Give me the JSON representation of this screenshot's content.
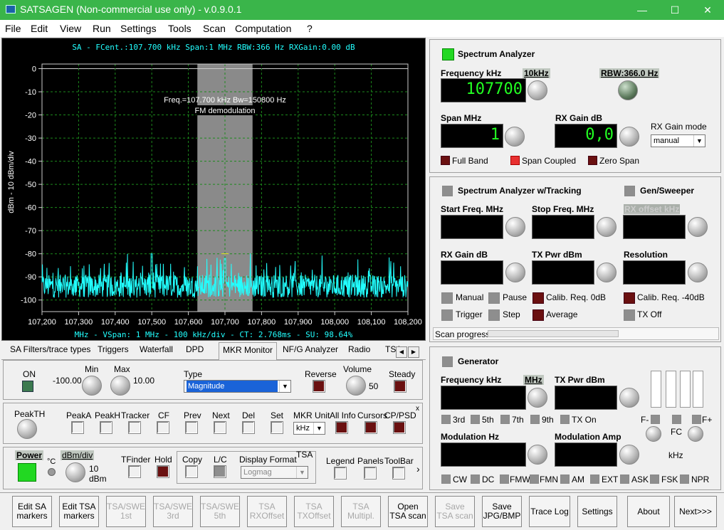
{
  "window": {
    "title": "SATSAGEN (Non-commercial use only) - v.0.9.0.1",
    "minimize": "—",
    "maximize": "☐",
    "close": "✕"
  },
  "menu": [
    "File",
    "Edit",
    "View",
    "Run",
    "Settings",
    "Tools",
    "Scan",
    "Computation",
    "?"
  ],
  "plot": {
    "header": "SA - FCent.:107.700 kHz Span:1 MHz RBW:366 Hz RXGain:0.00 dB",
    "footer": "MHz - VSpan: 1 MHz - 100 kHz/div - CT: 2.768ms - SU: 98.64%",
    "ylabel": "dBm - 10 dBm/div",
    "yticks": [
      "0",
      "-10",
      "-20",
      "-30",
      "-40",
      "-50",
      "-60",
      "-70",
      "-80",
      "-90",
      "-100"
    ],
    "xticks": [
      "107,200",
      "107,300",
      "107,400",
      "107,500",
      "107,600",
      "107,700",
      "107,800",
      "107,900",
      "108,000",
      "108,100",
      "108,200"
    ],
    "band_label1": "Freq.=107.700 kHz Bw=150800 Hz",
    "band_label2": "FM demodulation"
  },
  "chart_data": {
    "type": "line",
    "x_range": [
      107.2,
      108.2
    ],
    "ylim": [
      -105,
      2
    ],
    "xlabel": "MHz",
    "ylabel": "dBm - 10 dBm/div",
    "noise_floor_dbm": -96,
    "peaks": [
      {
        "x": 107.5,
        "y": -80
      },
      {
        "x": 107.7,
        "y": -82
      }
    ],
    "band": {
      "center_khz": 107700,
      "bw_hz": 150800
    },
    "grid": true,
    "color": "#22ffff"
  },
  "tabs": [
    "SA Filters/trace types",
    "Triggers",
    "Waterfall",
    "DPD",
    "MKR Monitor",
    "NF/G Analyzer",
    "Radio",
    "TSA"
  ],
  "mkr_monitor": {
    "on": "ON",
    "min_label": "Min",
    "min_value": "-100.00",
    "max_label": "Max",
    "max_value": "10.00",
    "type_label": "Type",
    "type_value": "Magnitude",
    "reverse": "Reverse",
    "volume_label": "Volume",
    "volume_value": "50",
    "steady": "Steady"
  },
  "markers": {
    "peakth": "PeakTH",
    "peaka": "PeakA",
    "peakh": "PeakH",
    "tracker": "Tracker",
    "cf": "CF",
    "prev": "Prev",
    "next": "Next",
    "del": "Del",
    "set": "Set",
    "unit_label": "MKR Unit",
    "unit_value": "kHz",
    "allinfo": "All Info",
    "cursors": "Cursors",
    "cppsd": "CP/PSD",
    "close": "x"
  },
  "bottom_tool": {
    "power": "Power",
    "degc": "°C",
    "dbm_div": "dBm/div",
    "dbm_div_value": "10",
    "dbm_unit": "dBm",
    "tfinder": "TFinder",
    "hold": "Hold",
    "copy": "Copy",
    "lc": "L/C",
    "display_format": "Display Format",
    "display_format_value": "Logmag",
    "tsa": "TSA",
    "legend": "Legend",
    "panels": "Panels",
    "toolbar": "ToolBar",
    "more": "›"
  },
  "sa": {
    "title": "Spectrum Analyzer",
    "freq_label": "Frequency kHz",
    "step": "10kHz",
    "rbw": "RBW:366.0 Hz",
    "freq_value": "107700",
    "span_label": "Span MHz",
    "span_value": "1",
    "gain_label": "RX Gain dB",
    "gain_value": "0,0",
    "gain_mode_label": "RX Gain mode",
    "gain_mode_value": "manual",
    "full_band": "Full Band",
    "span_coupled": "Span Coupled",
    "zero_span": "Zero Span"
  },
  "tracking": {
    "title": "Spectrum Analyzer w/Tracking",
    "gen_title": "Gen/Sweeper",
    "start": "Start Freq. MHz",
    "stop": "Stop Freq. MHz",
    "rx_offset": "RX offset kHz",
    "rx_gain": "RX Gain dB",
    "tx_pwr": "TX Pwr dBm",
    "resolution": "Resolution",
    "manual": "Manual",
    "pause": "Pause",
    "calib0": "Calib. Req. 0dB",
    "calib40": "Calib. Req. -40dB",
    "trigger": "Trigger",
    "step": "Step",
    "average": "Average",
    "txoff": "TX Off",
    "scan_progress": "Scan progress"
  },
  "generator": {
    "title": "Generator",
    "freq_label": "Frequency kHz",
    "unit": "MHz",
    "txpwr": "TX Pwr dBm",
    "h3": "3rd",
    "h5": "5th",
    "h7": "7th",
    "h9": "9th",
    "txon": "TX On",
    "fminus": "F-",
    "fplus": "F+",
    "fc": "FC",
    "khz": "kHz",
    "mod_hz": "Modulation Hz",
    "mod_amp": "Modulation Amp",
    "modes": [
      "CW",
      "DC",
      "FMW",
      "FMN",
      "AM",
      "EXT",
      "ASK",
      "FSK",
      "NPR"
    ]
  },
  "buttons": [
    {
      "label": "Edit SA\nmarkers",
      "enabled": true
    },
    {
      "label": "Edit TSA\nmarkers",
      "enabled": true
    },
    {
      "label": "TSA/SWE\n1st",
      "enabled": false
    },
    {
      "label": "TSA/SWE\n3rd",
      "enabled": false
    },
    {
      "label": "TSA/SWE\n5th",
      "enabled": false
    },
    {
      "label": "TSA\nRXOffset",
      "enabled": false
    },
    {
      "label": "TSA\nTXOffset",
      "enabled": false
    },
    {
      "label": "TSA\nMultipl.",
      "enabled": false
    },
    {
      "label": "Open\nTSA scan",
      "enabled": true
    },
    {
      "label": "Save\nTSA scan",
      "enabled": false
    },
    {
      "label": "Save\nJPG/BMP",
      "enabled": true
    },
    {
      "label": "Trace Log",
      "enabled": true
    },
    {
      "label": "Settings",
      "enabled": true
    },
    {
      "label": "About",
      "enabled": true
    },
    {
      "label": "Next>>>",
      "enabled": true
    }
  ]
}
